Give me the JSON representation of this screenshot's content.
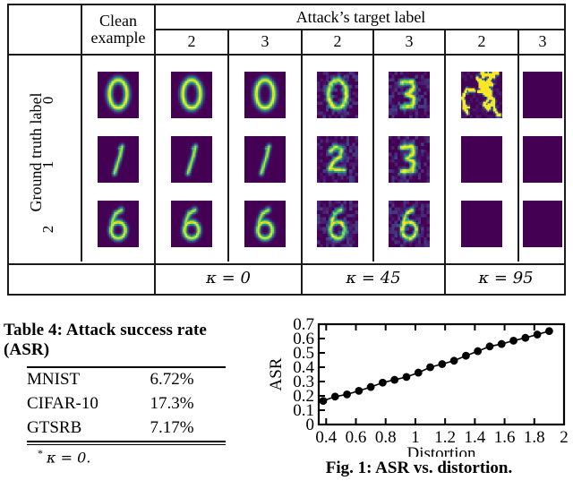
{
  "figure_table": {
    "col_headers": {
      "clean_example": "Clean\nexample",
      "attack_target_label": "Attack’s target label",
      "targets": [
        "2",
        "3",
        "2",
        "3",
        "2",
        "3"
      ]
    },
    "row_axis_label": "Ground truth label",
    "row_labels": [
      "0",
      "1",
      "2"
    ],
    "kappa_groups": [
      {
        "label": "κ = 0",
        "span": 2
      },
      {
        "label": "κ = 45",
        "span": 2
      },
      {
        "label": "κ = 95",
        "span": 2
      }
    ],
    "cells": [
      {
        "row": "0",
        "col": "clean",
        "kind": "digit-0",
        "name": "clean-digit-0"
      },
      {
        "row": "0",
        "col": "k0-t2",
        "kind": "digit-0",
        "name": "adv-digit-0-k0-target2"
      },
      {
        "row": "0",
        "col": "k0-t3",
        "kind": "digit-0",
        "name": "adv-digit-0-k0-target3"
      },
      {
        "row": "0",
        "col": "k45-t2",
        "kind": "digit-0-noisy",
        "name": "adv-digit-0-k45-target2"
      },
      {
        "row": "0",
        "col": "k45-t3",
        "kind": "digit-3-noisy",
        "name": "adv-digit-0-k45-target3"
      },
      {
        "row": "0",
        "col": "k95-t2",
        "kind": "scribble",
        "name": "adv-digit-0-k95-target2"
      },
      {
        "row": "0",
        "col": "k95-t3",
        "kind": "blank",
        "name": "adv-digit-0-k95-target3"
      },
      {
        "row": "1",
        "col": "clean",
        "kind": "digit-1",
        "name": "clean-digit-1"
      },
      {
        "row": "1",
        "col": "k0-t2",
        "kind": "digit-1",
        "name": "adv-digit-1-k0-target2"
      },
      {
        "row": "1",
        "col": "k0-t3",
        "kind": "digit-1",
        "name": "adv-digit-1-k0-target3"
      },
      {
        "row": "1",
        "col": "k45-t2",
        "kind": "digit-2-noisy",
        "name": "adv-digit-1-k45-target2"
      },
      {
        "row": "1",
        "col": "k45-t3",
        "kind": "digit-3b-noisy",
        "name": "adv-digit-1-k45-target3"
      },
      {
        "row": "1",
        "col": "k95-t2",
        "kind": "blank",
        "name": "adv-digit-1-k95-target2"
      },
      {
        "row": "1",
        "col": "k95-t3",
        "kind": "blank",
        "name": "adv-digit-1-k95-target3"
      },
      {
        "row": "2",
        "col": "clean",
        "kind": "digit-6",
        "name": "clean-digit-2"
      },
      {
        "row": "2",
        "col": "k0-t2",
        "kind": "digit-6",
        "name": "adv-digit-2-k0-target2"
      },
      {
        "row": "2",
        "col": "k0-t3",
        "kind": "digit-6",
        "name": "adv-digit-2-k0-target3"
      },
      {
        "row": "2",
        "col": "k45-t2",
        "kind": "digit-6-noisy",
        "name": "adv-digit-2-k45-target2"
      },
      {
        "row": "2",
        "col": "k45-t3",
        "kind": "digit-6-noisy2",
        "name": "adv-digit-2-k45-target3"
      },
      {
        "row": "2",
        "col": "k95-t2",
        "kind": "blank",
        "name": "adv-digit-2-k95-target2"
      },
      {
        "row": "2",
        "col": "k95-t3",
        "kind": "blank",
        "name": "adv-digit-2-k95-target3"
      }
    ],
    "colors": {
      "background": "#3b0a54",
      "low": "#440154",
      "mid": "#31688e",
      "teal": "#21918c",
      "green": "#5ec962",
      "high": "#fde725",
      "border": "#1a1a1a"
    }
  },
  "table4": {
    "caption": "Table 4: Attack success rate (ASR)",
    "rows": [
      {
        "dataset": "MNIST",
        "asr": "6.72%"
      },
      {
        "dataset": "CIFAR-10",
        "asr": "17.3%"
      },
      {
        "dataset": "GTSRB",
        "asr": "7.17%"
      }
    ],
    "footnote_marker": "*",
    "footnote": "κ = 0."
  },
  "figure1": {
    "caption": "Fig. 1: ASR vs. distortion."
  },
  "chart_data": {
    "type": "line",
    "title": "",
    "xlabel": "Distortion",
    "ylabel": "ASR",
    "xlim": [
      0.35,
      2.0
    ],
    "ylim": [
      0,
      0.7
    ],
    "xticks": [
      "0.4",
      "0.6",
      "0.8",
      "1",
      "1.2",
      "1.4",
      "1.6",
      "1.8",
      "2"
    ],
    "xtick_values": [
      0.4,
      0.6,
      0.8,
      1.0,
      1.2,
      1.4,
      1.6,
      1.8,
      2.0
    ],
    "yticks": [
      "0",
      "0.1",
      "0.2",
      "0.3",
      "0.4",
      "0.5",
      "0.6",
      "0.7"
    ],
    "ytick_values": [
      0,
      0.1,
      0.2,
      0.3,
      0.4,
      0.5,
      0.6,
      0.7
    ],
    "grid": false,
    "legend": false,
    "marker": "filled-circle",
    "series": [
      {
        "name": "ASR",
        "x": [
          0.38,
          0.46,
          0.54,
          0.62,
          0.7,
          0.78,
          0.86,
          0.94,
          1.02,
          1.1,
          1.18,
          1.26,
          1.34,
          1.42,
          1.5,
          1.58,
          1.66,
          1.74,
          1.82,
          1.9
        ],
        "y": [
          0.165,
          0.195,
          0.21,
          0.235,
          0.262,
          0.292,
          0.312,
          0.332,
          0.362,
          0.4,
          0.422,
          0.445,
          0.48,
          0.512,
          0.545,
          0.562,
          0.585,
          0.605,
          0.628,
          0.652
        ]
      }
    ]
  }
}
